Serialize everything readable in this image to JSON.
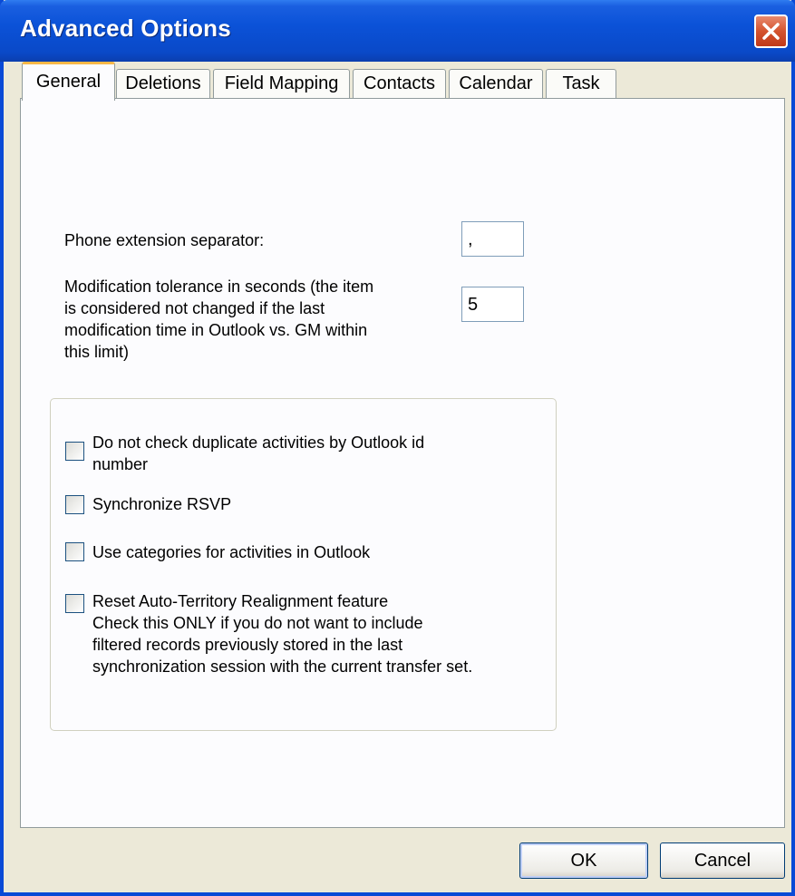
{
  "window": {
    "title": "Advanced Options"
  },
  "tabs": [
    {
      "label": "General",
      "active": true
    },
    {
      "label": "Deletions",
      "active": false
    },
    {
      "label": "Field Mapping",
      "active": false
    },
    {
      "label": "Contacts",
      "active": false
    },
    {
      "label": "Calendar",
      "active": false
    },
    {
      "label": "Task",
      "active": false
    }
  ],
  "general": {
    "phone_separator_label": "Phone extension separator:",
    "phone_separator_value": ",",
    "tolerance_label_lines": [
      "Modification tolerance in seconds (the item",
      "is considered not changed if the last",
      "modification time in Outlook vs. GM within",
      "this limit)"
    ],
    "tolerance_value": "5",
    "options": [
      {
        "lines": [
          "Do not check duplicate activities by Outlook id",
          "number"
        ],
        "checked": false
      },
      {
        "lines": [
          "Synchronize RSVP"
        ],
        "checked": false
      },
      {
        "lines": [
          "Use categories for activities in Outlook"
        ],
        "checked": false
      },
      {
        "lines": [
          "Reset Auto-Territory Realignment feature",
          "Check this ONLY if you do not want to include",
          "filtered records previously stored in the last",
          "synchronization session with the current transfer set."
        ],
        "checked": false
      }
    ]
  },
  "buttons": {
    "ok": "OK",
    "cancel": "Cancel"
  },
  "colors": {
    "titlebar": "#0a49c8",
    "active_tab_accent": "#f8b848",
    "close_button": "#d4532e"
  }
}
